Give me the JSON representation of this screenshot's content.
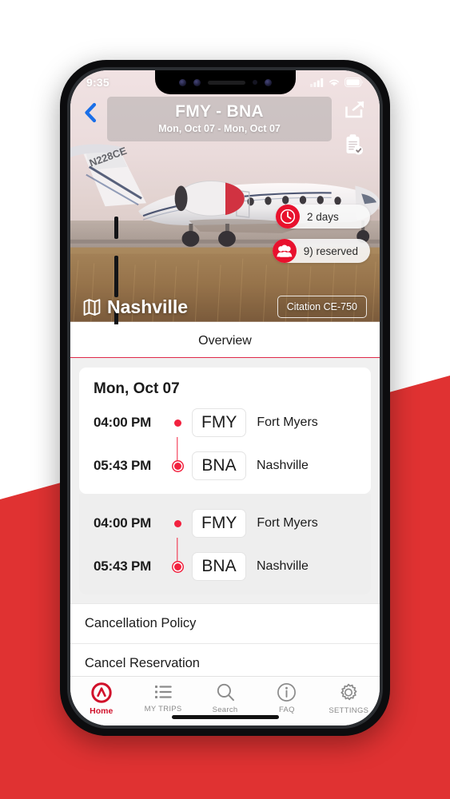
{
  "status_bar": {
    "time": "9:35",
    "icons": [
      "cellular-signal-icon",
      "wifi-icon",
      "battery-icon"
    ]
  },
  "header": {
    "back_icon": "chevron-left-icon",
    "title": "FMY - BNA",
    "subtitle": "Mon, Oct 07 - Mon, Oct 07",
    "actions": [
      {
        "name": "share-icon",
        "label": "Share"
      },
      {
        "name": "clipboard-check-icon",
        "label": "Trip Documents"
      }
    ]
  },
  "hero": {
    "badges": [
      {
        "icon": "clock-icon",
        "text": "2 days"
      },
      {
        "icon": "people-icon",
        "text": "9) reserved"
      }
    ],
    "city_icon": "map-icon",
    "city": "Nashville",
    "aircraft": "Citation CE-750",
    "tail_number": "N228CE"
  },
  "tabs": {
    "items": [
      {
        "label": "Overview",
        "active": true
      }
    ]
  },
  "itinerary": [
    {
      "date": "Mon, Oct 07",
      "legs": [
        {
          "time": "04:00 PM",
          "code": "FMY",
          "city": "Fort Myers",
          "marker": "departure"
        },
        {
          "time": "05:43 PM",
          "code": "BNA",
          "city": "Nashville",
          "marker": "arrival"
        }
      ]
    },
    {
      "date": "",
      "legs": [
        {
          "time": "04:00 PM",
          "code": "FMY",
          "city": "Fort Myers",
          "marker": "departure"
        },
        {
          "time": "05:43 PM",
          "code": "BNA",
          "city": "Nashville",
          "marker": "arrival"
        }
      ]
    }
  ],
  "list_rows": [
    {
      "label": "Cancellation Policy"
    },
    {
      "label": "Cancel Reservation"
    }
  ],
  "tabbar": [
    {
      "icon": "app-logo-icon",
      "label": "Home",
      "active": true
    },
    {
      "icon": "list-icon",
      "label": "MY TRIPS",
      "active": false
    },
    {
      "icon": "search-icon",
      "label": "Search",
      "active": false
    },
    {
      "icon": "info-icon",
      "label": "FAQ",
      "active": false
    },
    {
      "icon": "gear-icon",
      "label": "SETTINGS",
      "active": false
    }
  ],
  "colors": {
    "brand_red": "#e03232",
    "accent_red": "#e8112d",
    "marker_red": "#f2223f",
    "tab_active": "#d1112b",
    "back_blue": "#1a6fe8"
  }
}
